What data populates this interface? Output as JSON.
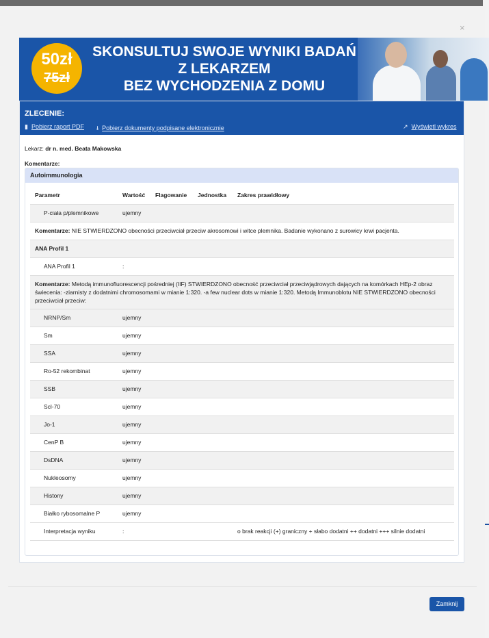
{
  "banner": {
    "price_new": "50zł",
    "price_old": "75zł",
    "line1": "SKONSULTUJ SWOJE WYNIKI BADAŃ",
    "line2": "Z LEKARZEM",
    "line3": "BEZ WYCHODZENIA Z DOMU"
  },
  "card": {
    "title": "ZLECENIE:",
    "link_pdf": "Pobierz raport PDF",
    "link_docs": "Pobierz dokumenty podpisane elektronicznie",
    "link_chart": "Wyświetl wykres"
  },
  "meta": {
    "doctor_label": "Lekarz:",
    "doctor_name": "dr n. med. Beata Makowska",
    "comments_label": "Komentarze:"
  },
  "section": {
    "title": "Autoimmunologia",
    "columns": [
      "Parametr",
      "Wartość",
      "Flagowanie",
      "Jednostka",
      "Zakres prawidłowy"
    ],
    "row_p": {
      "param": "P-ciała p/plemnikowe",
      "value": "ujemny"
    },
    "comment1_label": "Komentarze:",
    "comment1_text": "NIE STWIERDZONO obecności przeciwciał przeciw akrosomowi i witce plemnika. Badanie wykonano z surowicy krwi pacjenta.",
    "group_ana": "ANA Profil 1",
    "row_ana": {
      "param": "ANA Profil 1",
      "value": ":"
    },
    "comment2_label": "Komentarze:",
    "comment2_text": "Metodą immunofluorescencji pośredniej (IIF) STWIERDZONO obecność przeciwciał przeciwjądrowych dających na komórkach HEp-2 obraz świecenia: -ziarnisty z dodatnimi chromosomami w mianie 1:320. -a few nuclear dots w mianie 1:320. Metodą Immunoblotu NIE STWIERDZONO obecności przeciwciał przeciw:",
    "rows": [
      {
        "param": "NRNP/Sm",
        "value": "ujemny"
      },
      {
        "param": "Sm",
        "value": "ujemny"
      },
      {
        "param": "SSA",
        "value": "ujemny"
      },
      {
        "param": "Ro-52 rekombinat",
        "value": "ujemny"
      },
      {
        "param": "SSB",
        "value": "ujemny"
      },
      {
        "param": "Scl-70",
        "value": "ujemny"
      },
      {
        "param": "Jo-1",
        "value": "ujemny"
      },
      {
        "param": "CenP B",
        "value": "ujemny"
      },
      {
        "param": "DsDNA",
        "value": "ujemny"
      },
      {
        "param": "Nukleosomy",
        "value": "ujemny"
      },
      {
        "param": "Histony",
        "value": "ujemny"
      },
      {
        "param": "Białko rybosomalne P",
        "value": "ujemny"
      }
    ],
    "interp": {
      "param": "Interpretacja wyniku",
      "value": ":",
      "range": "o brak reakcji (+) graniczny + słabo dodatni ++ dodatni +++ silnie dodatni"
    }
  },
  "close_label": "Zamknij",
  "close_x": "×",
  "colors": {
    "primary": "#1a55a8",
    "section_head": "#d9e2f7",
    "price": "#f5b400"
  }
}
